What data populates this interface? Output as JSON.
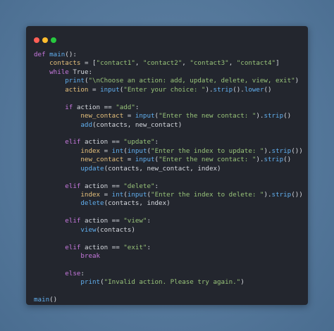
{
  "window": {
    "controls": [
      {
        "name": "close-dot",
        "color": "#ff5f56"
      },
      {
        "name": "minimize-dot",
        "color": "#ffbd2e"
      },
      {
        "name": "maximize-dot",
        "color": "#27c93f"
      }
    ]
  },
  "code_lines": [
    [
      {
        "t": "kw",
        "v": "def "
      },
      {
        "t": "fn",
        "v": "main"
      },
      {
        "t": "plain",
        "v": "():"
      }
    ],
    [
      {
        "t": "plain",
        "v": "    "
      },
      {
        "t": "var",
        "v": "contacts"
      },
      {
        "t": "plain",
        "v": " = ["
      },
      {
        "t": "str",
        "v": "\"contact1\""
      },
      {
        "t": "plain",
        "v": ", "
      },
      {
        "t": "str",
        "v": "\"contact2\""
      },
      {
        "t": "plain",
        "v": ", "
      },
      {
        "t": "str",
        "v": "\"contact3\""
      },
      {
        "t": "plain",
        "v": ", "
      },
      {
        "t": "str",
        "v": "\"contact4\""
      },
      {
        "t": "plain",
        "v": "]"
      }
    ],
    [
      {
        "t": "plain",
        "v": "    "
      },
      {
        "t": "kw",
        "v": "while"
      },
      {
        "t": "plain",
        "v": " True:"
      }
    ],
    [
      {
        "t": "plain",
        "v": "        "
      },
      {
        "t": "fn",
        "v": "print"
      },
      {
        "t": "plain",
        "v": "("
      },
      {
        "t": "str",
        "v": "\"\\nChoose an action: add, update, delete, view, exit\""
      },
      {
        "t": "plain",
        "v": ")"
      }
    ],
    [
      {
        "t": "plain",
        "v": "        "
      },
      {
        "t": "var",
        "v": "action"
      },
      {
        "t": "plain",
        "v": " = "
      },
      {
        "t": "fn",
        "v": "input"
      },
      {
        "t": "plain",
        "v": "("
      },
      {
        "t": "str",
        "v": "\"Enter your choice: \""
      },
      {
        "t": "plain",
        "v": ")."
      },
      {
        "t": "fn",
        "v": "strip"
      },
      {
        "t": "plain",
        "v": "()."
      },
      {
        "t": "fn",
        "v": "lower"
      },
      {
        "t": "plain",
        "v": "()"
      }
    ],
    [],
    [
      {
        "t": "plain",
        "v": "        "
      },
      {
        "t": "kw",
        "v": "if"
      },
      {
        "t": "plain",
        "v": " action == "
      },
      {
        "t": "str",
        "v": "\"add\""
      },
      {
        "t": "plain",
        "v": ":"
      }
    ],
    [
      {
        "t": "plain",
        "v": "            "
      },
      {
        "t": "var",
        "v": "new_contact"
      },
      {
        "t": "plain",
        "v": " = "
      },
      {
        "t": "fn",
        "v": "input"
      },
      {
        "t": "plain",
        "v": "("
      },
      {
        "t": "str",
        "v": "\"Enter the new contact: \""
      },
      {
        "t": "plain",
        "v": ")."
      },
      {
        "t": "fn",
        "v": "strip"
      },
      {
        "t": "plain",
        "v": "()"
      }
    ],
    [
      {
        "t": "plain",
        "v": "            "
      },
      {
        "t": "fn",
        "v": "add"
      },
      {
        "t": "plain",
        "v": "(contacts, new_contact)"
      }
    ],
    [],
    [
      {
        "t": "plain",
        "v": "        "
      },
      {
        "t": "kw",
        "v": "elif"
      },
      {
        "t": "plain",
        "v": " action == "
      },
      {
        "t": "str",
        "v": "\"update\""
      },
      {
        "t": "plain",
        "v": ":"
      }
    ],
    [
      {
        "t": "plain",
        "v": "            "
      },
      {
        "t": "var",
        "v": "index"
      },
      {
        "t": "plain",
        "v": " = "
      },
      {
        "t": "fn",
        "v": "int"
      },
      {
        "t": "plain",
        "v": "("
      },
      {
        "t": "fn",
        "v": "input"
      },
      {
        "t": "plain",
        "v": "("
      },
      {
        "t": "str",
        "v": "\"Enter the index to update: \""
      },
      {
        "t": "plain",
        "v": ")."
      },
      {
        "t": "fn",
        "v": "strip"
      },
      {
        "t": "plain",
        "v": "())"
      }
    ],
    [
      {
        "t": "plain",
        "v": "            "
      },
      {
        "t": "var",
        "v": "new_contact"
      },
      {
        "t": "plain",
        "v": " = "
      },
      {
        "t": "fn",
        "v": "input"
      },
      {
        "t": "plain",
        "v": "("
      },
      {
        "t": "str",
        "v": "\"Enter the new contact: \""
      },
      {
        "t": "plain",
        "v": ")."
      },
      {
        "t": "fn",
        "v": "strip"
      },
      {
        "t": "plain",
        "v": "()"
      }
    ],
    [
      {
        "t": "plain",
        "v": "            "
      },
      {
        "t": "fn",
        "v": "update"
      },
      {
        "t": "plain",
        "v": "(contacts, new_contact, index)"
      }
    ],
    [],
    [
      {
        "t": "plain",
        "v": "        "
      },
      {
        "t": "kw",
        "v": "elif"
      },
      {
        "t": "plain",
        "v": " action == "
      },
      {
        "t": "str",
        "v": "\"delete\""
      },
      {
        "t": "plain",
        "v": ":"
      }
    ],
    [
      {
        "t": "plain",
        "v": "            "
      },
      {
        "t": "var",
        "v": "index"
      },
      {
        "t": "plain",
        "v": " = "
      },
      {
        "t": "fn",
        "v": "int"
      },
      {
        "t": "plain",
        "v": "("
      },
      {
        "t": "fn",
        "v": "input"
      },
      {
        "t": "plain",
        "v": "("
      },
      {
        "t": "str",
        "v": "\"Enter the index to delete: \""
      },
      {
        "t": "plain",
        "v": ")."
      },
      {
        "t": "fn",
        "v": "strip"
      },
      {
        "t": "plain",
        "v": "())"
      }
    ],
    [
      {
        "t": "plain",
        "v": "            "
      },
      {
        "t": "fn",
        "v": "delete"
      },
      {
        "t": "plain",
        "v": "(contacts, index)"
      }
    ],
    [],
    [
      {
        "t": "plain",
        "v": "        "
      },
      {
        "t": "kw",
        "v": "elif"
      },
      {
        "t": "plain",
        "v": " action == "
      },
      {
        "t": "str",
        "v": "\"view\""
      },
      {
        "t": "plain",
        "v": ":"
      }
    ],
    [
      {
        "t": "plain",
        "v": "            "
      },
      {
        "t": "fn",
        "v": "view"
      },
      {
        "t": "plain",
        "v": "(contacts)"
      }
    ],
    [],
    [
      {
        "t": "plain",
        "v": "        "
      },
      {
        "t": "kw",
        "v": "elif"
      },
      {
        "t": "plain",
        "v": " action == "
      },
      {
        "t": "str",
        "v": "\"exit\""
      },
      {
        "t": "plain",
        "v": ":"
      }
    ],
    [
      {
        "t": "plain",
        "v": "            "
      },
      {
        "t": "kw",
        "v": "break"
      }
    ],
    [],
    [
      {
        "t": "plain",
        "v": "        "
      },
      {
        "t": "kw",
        "v": "else"
      },
      {
        "t": "plain",
        "v": ":"
      }
    ],
    [
      {
        "t": "plain",
        "v": "            "
      },
      {
        "t": "fn",
        "v": "print"
      },
      {
        "t": "plain",
        "v": "("
      },
      {
        "t": "str",
        "v": "\"Invalid action. Please try again.\""
      },
      {
        "t": "plain",
        "v": ")"
      }
    ],
    [],
    [
      {
        "t": "fn",
        "v": "main"
      },
      {
        "t": "plain",
        "v": "()"
      }
    ]
  ]
}
